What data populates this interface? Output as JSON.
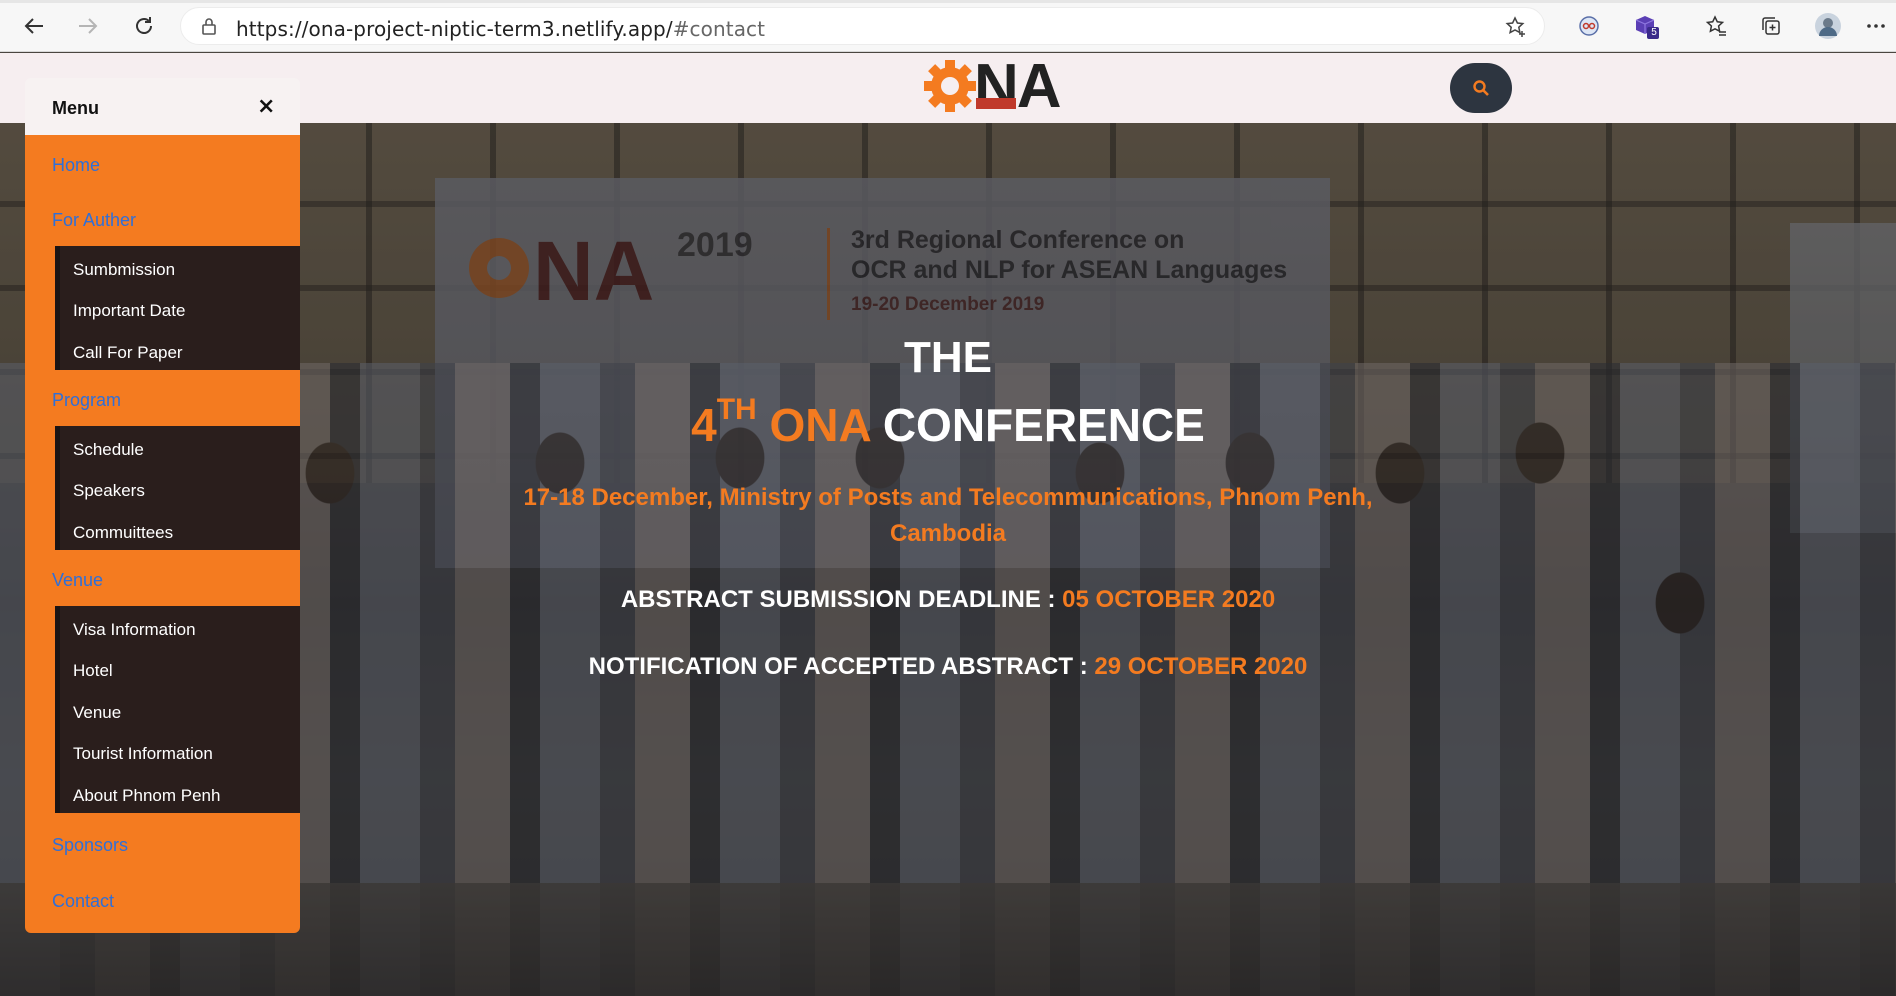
{
  "browser": {
    "url_host": "https://ona-project-niptic-term3.netlify.app/",
    "url_fragment": "#contact",
    "extension_badge": "5"
  },
  "header": {
    "logo_text": "NA",
    "search_label": "search"
  },
  "banner": {
    "year": "2019",
    "line1": "3rd Regional Conference on",
    "line2": "OCR and NLP for ASEAN Languages",
    "date": "19-20 December 2019"
  },
  "hero": {
    "the": "THE",
    "ordinal": "4",
    "ordinal_suffix": "TH",
    "ona": "ONA",
    "conference": "CONFERENCE",
    "place_line1": "17-18 December, Ministry of Posts and Telecommunications, Phnom Penh,",
    "place_line2": "Cambodia",
    "abstract_label": "ABSTRACT SUBMISSION DEADLINE :",
    "abstract_date": "05 OCTOBER 2020",
    "notif_label": "NOTIFICATION OF ACCEPTED ABSTRACT :",
    "notif_date": "29 OCTOBER 2020"
  },
  "menu": {
    "title": "Menu",
    "close": "×",
    "home": "Home",
    "for_auther": "For Auther",
    "auther_items": [
      "Sumbmission",
      "Important Date",
      "Call For Paper"
    ],
    "program": "Program",
    "program_items": [
      "Schedule",
      "Speakers",
      "Commuittees"
    ],
    "venue": "Venue",
    "venue_items": [
      "Visa Information",
      "Hotel",
      "Venue",
      "Tourist Information",
      "About Phnom Penh"
    ],
    "sponsors": "Sponsors",
    "contact": "Contact"
  },
  "colors": {
    "accent": "#f47b20",
    "submenu_bg": "#2a1e1c",
    "link": "#2f6fd8",
    "search_bg": "#2d3540"
  }
}
